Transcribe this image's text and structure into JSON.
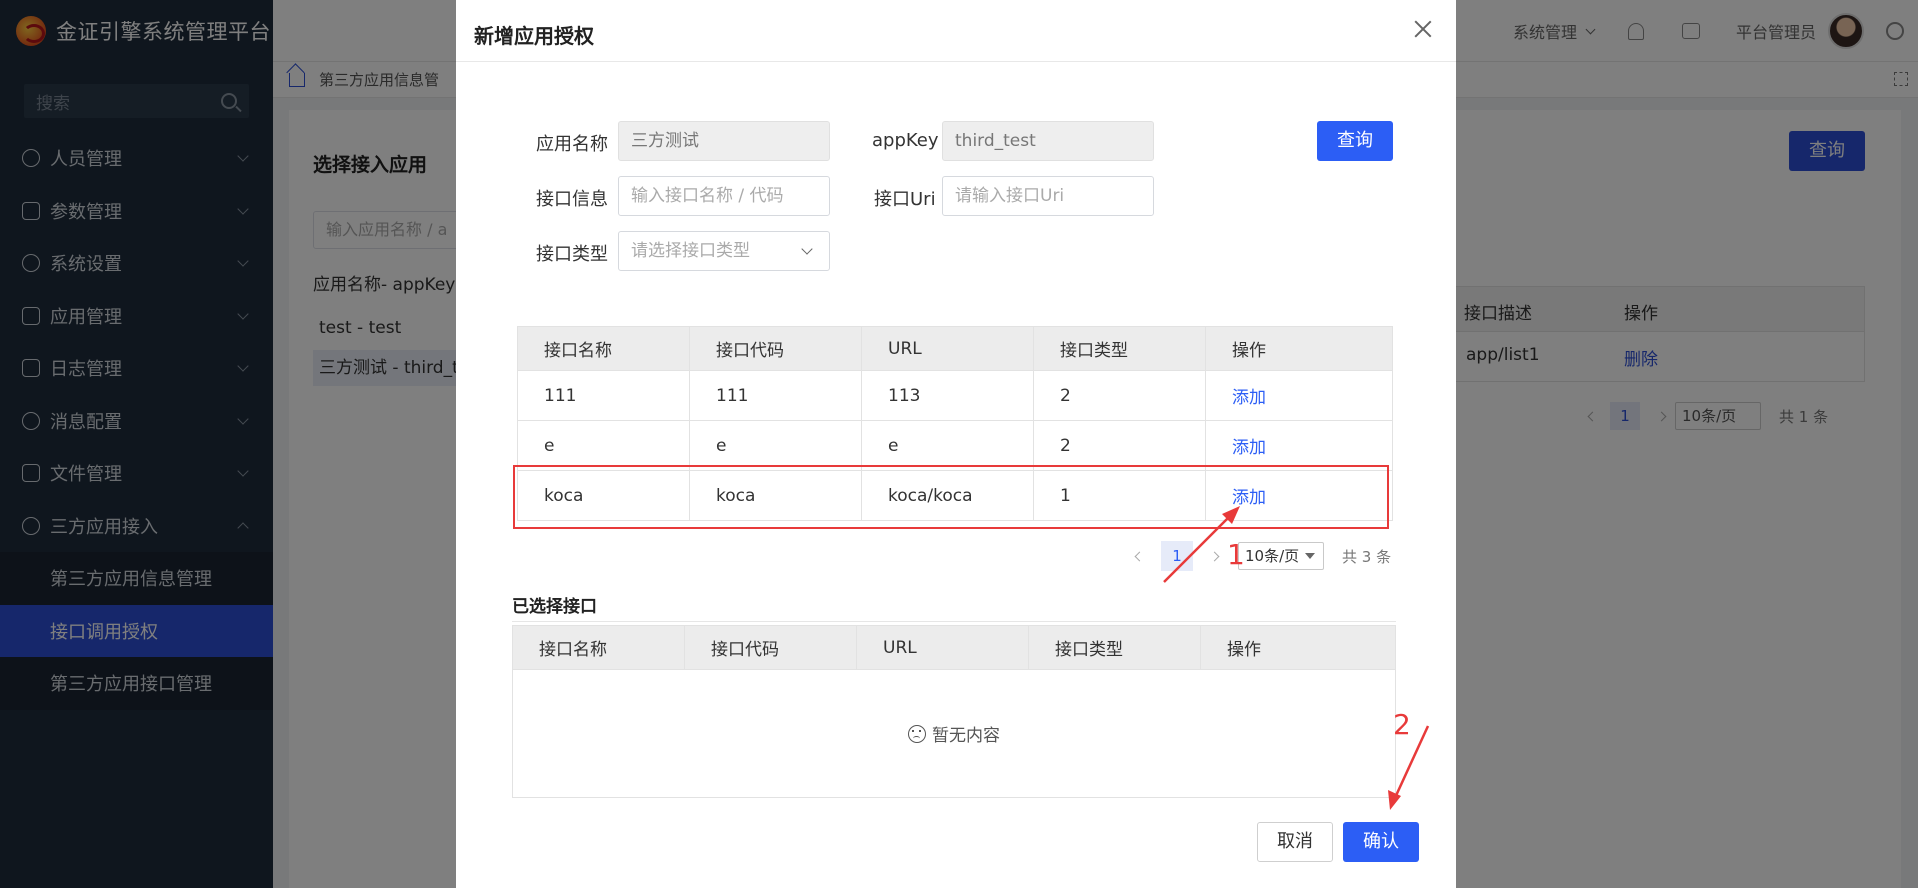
{
  "sidebar": {
    "brand": "金证引擎系统管理平台",
    "search_placeholder": "搜索",
    "menu": [
      {
        "label": "人员管理",
        "icon": "user-icon"
      },
      {
        "label": "参数管理",
        "icon": "sliders-icon"
      },
      {
        "label": "系统设置",
        "icon": "gear-icon"
      },
      {
        "label": "应用管理",
        "icon": "app-icon"
      },
      {
        "label": "日志管理",
        "icon": "log-icon"
      },
      {
        "label": "消息配置",
        "icon": "message-icon"
      },
      {
        "label": "文件管理",
        "icon": "file-icon"
      },
      {
        "label": "三方应用接入",
        "icon": "globe-icon"
      }
    ],
    "submenu": [
      {
        "label": "第三方应用信息管理"
      },
      {
        "label": "接口调用授权"
      },
      {
        "label": "第三方应用接口管理"
      }
    ]
  },
  "header": {
    "system_menu": "系统管理",
    "user": "平台管理员"
  },
  "breadcrumb": {
    "current": "第三方应用信息管"
  },
  "background": {
    "title": "选择接入应用",
    "search_placeholder": "输入应用名称 / a",
    "list_label": "应用名称- appKey",
    "items": [
      "test - test",
      "三方测试 - third_t"
    ],
    "query": "查询",
    "table_headers": [
      "接口描述",
      "操作"
    ],
    "row": [
      "app/list1",
      "删除"
    ],
    "pager": {
      "page": "1",
      "size": "10条/页",
      "total": "共 1 条"
    }
  },
  "modal": {
    "title": "新增应用授权",
    "form": {
      "app_name_label": "应用名称",
      "app_name_value": "三方测试",
      "appkey_label": "appKey",
      "appkey_value": "third_test",
      "query": "查询",
      "api_info_label": "接口信息",
      "api_info_placeholder": "输入接口名称 / 代码",
      "api_uri_label": "接口Uri",
      "api_uri_placeholder": "请输入接口Uri",
      "api_type_label": "接口类型",
      "api_type_placeholder": "请选择接口类型"
    },
    "table": {
      "headers": [
        "接口名称",
        "接口代码",
        "URL",
        "接口类型",
        "操作"
      ],
      "rows": [
        [
          "111",
          "111",
          "113",
          "2",
          "添加"
        ],
        [
          "e",
          "e",
          "e",
          "2",
          "添加"
        ],
        [
          "koca",
          "koca",
          "koca/koca",
          "1",
          "添加"
        ]
      ]
    },
    "pager": {
      "page": "1",
      "size": "10条/页",
      "total": "共 3 条"
    },
    "selected_title": "已选择接口",
    "selected_headers": [
      "接口名称",
      "接口代码",
      "URL",
      "接口类型",
      "操作"
    ],
    "empty_text": "暂无内容",
    "cancel": "取消",
    "confirm": "确认"
  },
  "annotations": {
    "step1": "1",
    "step2": "2",
    "color": "#e83a3a"
  }
}
